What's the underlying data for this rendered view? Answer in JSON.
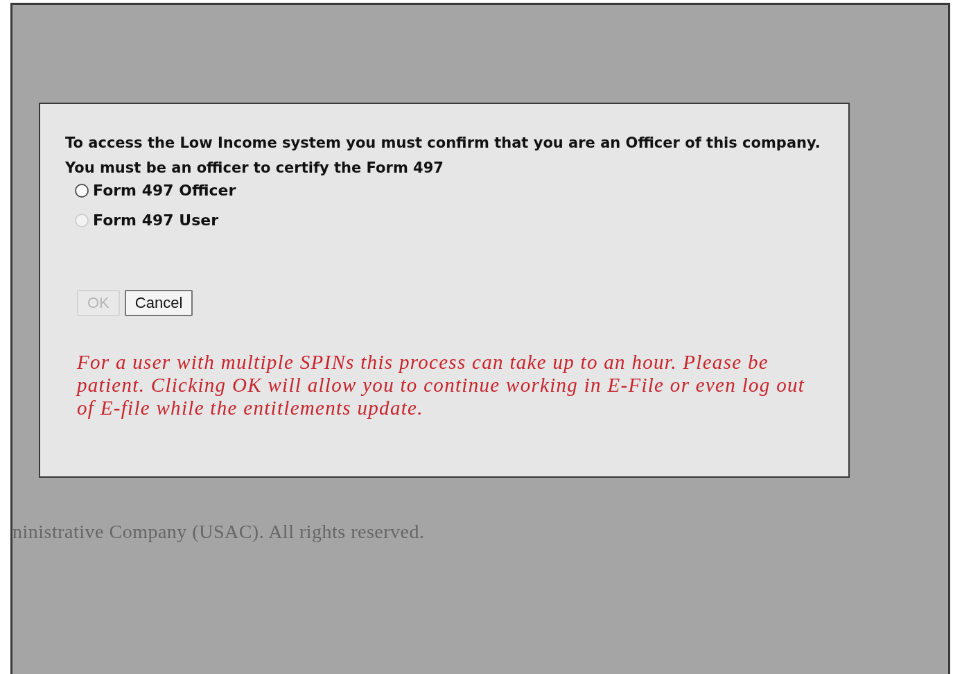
{
  "dialog": {
    "message": "To access the Low Income system you must confirm that you are an Officer of this company. You must be an officer to certify the Form 497",
    "options": [
      {
        "label": "Form 497 Officer",
        "checked": false,
        "disabled": false
      },
      {
        "label": "Form 497 User",
        "checked": false,
        "disabled": true
      }
    ],
    "buttons": [
      {
        "label": "OK",
        "disabled": true
      },
      {
        "label": "Cancel",
        "disabled": false
      }
    ],
    "note": "For a user with multiple SPINs this process can take up to an hour. Please be patient. Clicking OK will allow you to continue working in E-File or even log out of E-file while the entitlements update."
  },
  "footer": "ninistrative Company (USAC). All rights reserved."
}
